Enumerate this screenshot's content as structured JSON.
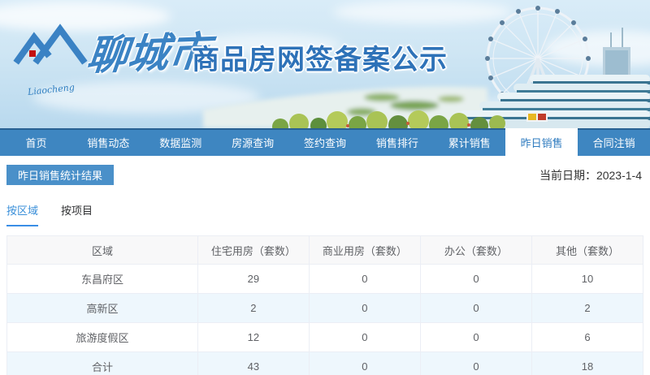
{
  "header": {
    "logo_script": "Liaocheng",
    "city_name": "聊城市",
    "site_title": "商品房网签备案公示"
  },
  "nav": {
    "items": [
      {
        "label": "首页",
        "active": false
      },
      {
        "label": "销售动态",
        "active": false
      },
      {
        "label": "数据监测",
        "active": false
      },
      {
        "label": "房源查询",
        "active": false
      },
      {
        "label": "签约查询",
        "active": false
      },
      {
        "label": "销售排行",
        "active": false
      },
      {
        "label": "累计销售",
        "active": false
      },
      {
        "label": "昨日销售",
        "active": true
      },
      {
        "label": "合同注销",
        "active": false
      }
    ]
  },
  "page": {
    "section_title": "昨日销售统计结果",
    "current_date": "当前日期：2023-1-4"
  },
  "subtabs": [
    {
      "label": "按区域",
      "active": true
    },
    {
      "label": "按项目",
      "active": false
    }
  ],
  "table": {
    "columns": [
      "区域",
      "住宅用房（套数）",
      "商业用房（套数）",
      "办公（套数）",
      "其他（套数）"
    ],
    "rows": [
      [
        "东昌府区",
        "29",
        "0",
        "0",
        "10"
      ],
      [
        "高新区",
        "2",
        "0",
        "0",
        "2"
      ],
      [
        "旅游度假区",
        "12",
        "0",
        "0",
        "6"
      ],
      [
        "合计",
        "43",
        "0",
        "0",
        "18"
      ]
    ]
  },
  "colors": {
    "nav_blue": "#3e86c1",
    "badge_blue": "#4a90c9",
    "active_tab_text": "#2e7bbf",
    "subtab_underline": "#3a8ee6",
    "table_header_bg": "#f8f8f9",
    "row_alt_bg": "#eef7fd",
    "table_border": "#ebeef5",
    "table_text": "#606266",
    "title_blue": "#2e72b8"
  }
}
